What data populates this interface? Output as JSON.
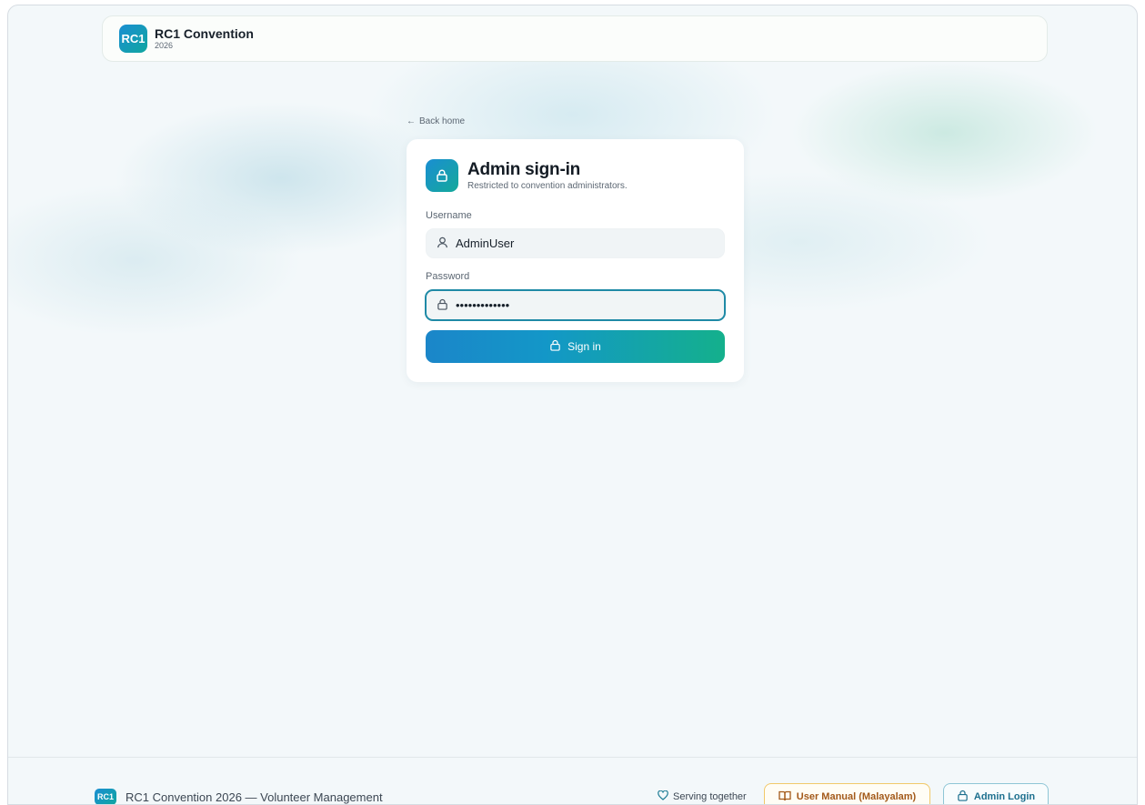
{
  "header": {
    "logo_text": "RC1",
    "brand_name": "RC1 Convention",
    "brand_year": "2026"
  },
  "back_link": {
    "arrow": "←",
    "label": "Back home"
  },
  "login": {
    "title": "Admin sign-in",
    "subtitle": "Restricted to convention administrators.",
    "username_label": "Username",
    "username_value": "AdminUser",
    "password_label": "Password",
    "password_value": "•••••••••••••",
    "submit_label": "Sign in"
  },
  "footer": {
    "logo_text": "RC1",
    "text": "RC1 Convention 2026 — Volunteer Management",
    "serving": "Serving together",
    "manual_label": "User Manual (Malayalam)",
    "admin_label": "Admin Login"
  },
  "colors": {
    "accent_blue": "#1a8ed2",
    "accent_teal": "#14b08c",
    "focus_ring": "#1f8aa6",
    "manual_border": "#f1c96a",
    "manual_text": "#a35a1a"
  },
  "icons": {
    "lock": "lock-icon",
    "user": "user-icon",
    "heart": "heart-icon",
    "book": "book-icon",
    "arrow_left": "arrow-left-icon"
  }
}
